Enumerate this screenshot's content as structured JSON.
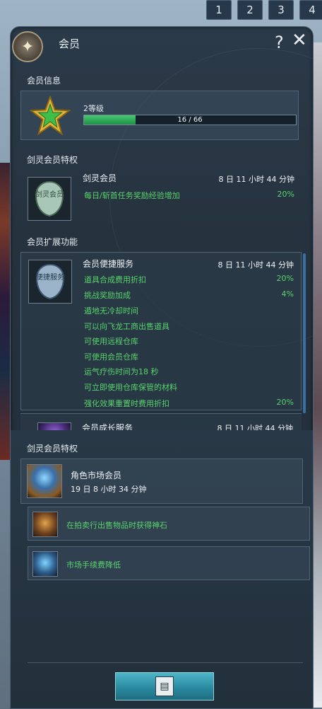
{
  "topbar": {
    "tabs": [
      "1",
      "2",
      "3",
      "4"
    ]
  },
  "window": {
    "title": "会员"
  },
  "member_info": {
    "section_title": "会员信息",
    "level_label": "2等级",
    "progress_text": "16 / 66",
    "progress_fraction": 0.2424
  },
  "privilege": {
    "section_title": "剑灵会员特权",
    "name": "剑灵会员",
    "time": "8 日 11 小时 44 分钟",
    "icon_text": "剑灵会员",
    "perks": [
      {
        "text": "每日/斩首任务奖励经验增加",
        "value": "20%"
      }
    ]
  },
  "extension": {
    "section_title": "会员扩展功能",
    "service": {
      "name": "会员便捷服务",
      "time": "8 日 11 小时 44 分钟",
      "icon_text": "便捷服务",
      "perks": [
        {
          "text": "道具合成费用折扣",
          "value": "20%"
        },
        {
          "text": "挑战奖励加成",
          "value": "4%"
        },
        {
          "text": "遁地无冷却时间",
          "value": ""
        },
        {
          "text": "可以向飞龙工商出售道具",
          "value": ""
        },
        {
          "text": "可使用远程仓库",
          "value": ""
        },
        {
          "text": "可使用会员仓库",
          "value": ""
        },
        {
          "text": "运气疗伤时间为18 秒",
          "value": ""
        },
        {
          "text": "可立即使用仓库保管的材料",
          "value": ""
        },
        {
          "text": "强化效果重置时费用折扣",
          "value": "20%"
        }
      ]
    },
    "growth": {
      "name": "会员成长服务",
      "time": "8 日 11 小时 44 分钟"
    }
  },
  "market": {
    "section_title": "剑灵会员特权",
    "name": "角色市场会员",
    "time": "19 日 8 小时 34 分钟",
    "benefits": [
      {
        "text": "在拍卖行出售物品时获得神石"
      },
      {
        "text": "市场手续费降低"
      }
    ]
  },
  "colors": {
    "perk_green": "#59d36d",
    "progress_green": "#2fae59",
    "button_teal": "#2a8aa0"
  },
  "icons": {
    "close": "close-icon",
    "help": "help-icon",
    "star": "star-icon",
    "bottom": "store-icon"
  }
}
